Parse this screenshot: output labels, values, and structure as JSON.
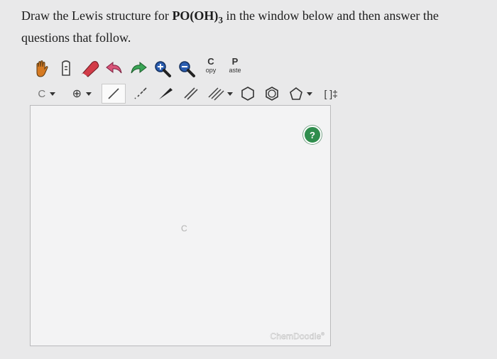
{
  "question": {
    "prefix": "Draw the Lewis structure for ",
    "formula": "PO(OH)",
    "subscript": "3",
    "suffix": " in the window below and then answer the questions that follow."
  },
  "toolbar": {
    "copy_big": "C",
    "copy_small": "opy",
    "paste_big": "P",
    "paste_small": "aste",
    "element_label": "C",
    "charge_symbol": "⊕",
    "bracket_label": "[ ]‡"
  },
  "canvas": {
    "atom_label": "C",
    "help_symbol": "?",
    "brand": "ChemDoodle",
    "brand_mark": "®"
  },
  "colors": {
    "help_green": "#2f8d4d",
    "eraser_red": "#d23c48",
    "zoom_blue": "#2a5db0"
  }
}
